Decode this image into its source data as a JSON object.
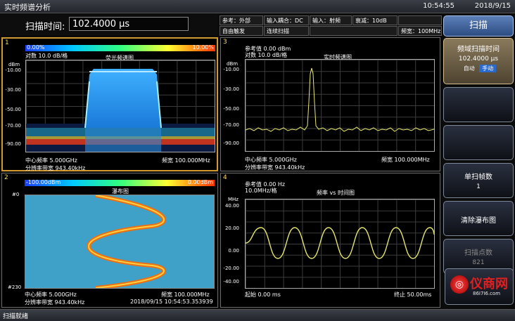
{
  "window": {
    "title": "实时频谱分析",
    "time": "10:54:55",
    "date": "2018/9/15"
  },
  "sweep": {
    "label": "扫描时间:",
    "value": "102.4000 µs"
  },
  "params": {
    "ref": "参考：外部",
    "coupling": "输入耦合：DC",
    "input": "输入：射频",
    "atten": "衰减：10dB",
    "trigger": "自由触发",
    "scan": "连续扫描",
    "span": "频宽：100MHz"
  },
  "panel1": {
    "num": "1",
    "cbar_left": "0.00%",
    "cbar_right": "10.00%",
    "scale": "对数 10.0 dB/格",
    "title": "荧光频谱图",
    "unit": "dBm",
    "yticks": [
      "-10.00",
      "-30.00",
      "-50.00",
      "-70.00",
      "-90.00"
    ],
    "center": "中心频率 5.000GHz",
    "span": "频宽 100.000MHz",
    "rbw": "分辨率带宽 943.40kHz"
  },
  "panel2": {
    "num": "2",
    "cbar_left": "-100.00dBm",
    "cbar_right": "0.00dBm",
    "title": "瀑布图",
    "top_mark": "#0",
    "bottom_mark": "#230",
    "center": "中心频率 5.000GHz",
    "span": "频宽 100.000MHz",
    "rbw": "分辨率带宽 943.40kHz",
    "timestamp": "2018/09/15 10:54:53.353939"
  },
  "panel3": {
    "num": "3",
    "ref": "参考值 0.00 dBm",
    "scale": "对数 10.0 dB/格",
    "title": "实时频谱图",
    "unit": "dBm",
    "yticks": [
      "-10.00",
      "-30.00",
      "-50.00",
      "-70.00",
      "-90.00"
    ],
    "center": "中心频率 5.000GHz",
    "span": "频宽 100.000MHz",
    "rbw": "分辨率带宽 943.40kHz"
  },
  "panel4": {
    "num": "4",
    "ref": "参考值 0.00 Hz",
    "scale": "10.0MHz/格",
    "title": "频率 vs 时间图",
    "unit": "MHz",
    "yticks": [
      "40.00",
      "20.00",
      "0.00",
      "-20.00",
      "-40.00"
    ],
    "start": "起始 0.00 ms",
    "stop": "终止 50.00ms"
  },
  "sidebar": {
    "head": "扫描",
    "btn1": {
      "l1": "频域扫描时间",
      "l2": "102.4000 µs",
      "auto": "自动",
      "manual": "手动"
    },
    "btn4": {
      "l1": "单扫帧数",
      "l2": "1"
    },
    "btn5": {
      "l1": "清除瀑布图"
    },
    "btn6": {
      "l1": "扫描点数",
      "l2": "821"
    }
  },
  "logo": {
    "name": "仪商网",
    "url": "86I7I6.com"
  },
  "status": {
    "text": "扫描就绪"
  },
  "colors": {
    "accent": "#d09a30",
    "trace": "#e8e870",
    "header_button": "#4a6ea8"
  }
}
